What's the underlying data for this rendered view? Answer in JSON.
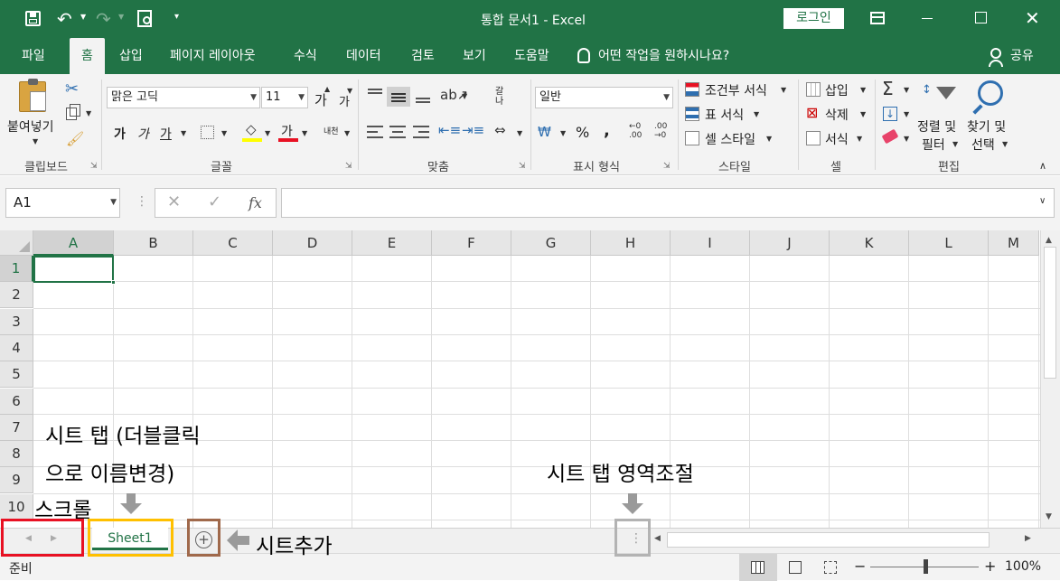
{
  "titlebar": {
    "title": "통합 문서1 - Excel",
    "login_label": "로그인",
    "bg_color": "#217346"
  },
  "ribbon_tabs": [
    "파일",
    "홈",
    "삽입",
    "페이지 레이아웃",
    "수식",
    "데이터",
    "검토",
    "보기",
    "도움말"
  ],
  "tell_me": "어떤 작업을 원하시나요?",
  "share_label": "공유",
  "clipboard": {
    "paste_label": "붙여넣기",
    "group_label": "클립보드"
  },
  "font": {
    "font_name": "맑은 고딕",
    "font_size": "11",
    "grow_label": "가",
    "shrink_label": "가",
    "bold": "가",
    "italic": "가",
    "underline": "가",
    "font_color_glyph": "가",
    "phonetic_glyph": "내천",
    "group_label": "글꼴"
  },
  "alignment": {
    "wrap_glyph": "갈나",
    "group_label": "맞춤"
  },
  "number": {
    "format": "일반",
    "percent": "%",
    "comma": ",",
    "group_label": "표시 형식"
  },
  "styles": {
    "conditional": "조건부 서식",
    "table": "표 서식",
    "cell_style": "셀 스타일",
    "group_label": "스타일"
  },
  "cells": {
    "insert": "삽입",
    "delete": "삭제",
    "format": "서식",
    "group_label": "셀"
  },
  "editing": {
    "sort_line1": "정렬 및",
    "sort_line2": "필터",
    "find_line1": "찾기 및",
    "find_line2": "선택",
    "group_label": "편집"
  },
  "formula_bar": {
    "name_box": "A1",
    "fx": "fx",
    "value": ""
  },
  "grid": {
    "columns": [
      "A",
      "B",
      "C",
      "D",
      "E",
      "F",
      "G",
      "H",
      "I",
      "J",
      "K",
      "L",
      "M"
    ],
    "rows": [
      "1",
      "2",
      "3",
      "4",
      "5",
      "6",
      "7",
      "8",
      "9",
      "10"
    ],
    "active_cell": "A1"
  },
  "sheet_tabs": {
    "tabs": [
      "Sheet1"
    ]
  },
  "annotations": {
    "tab_line1": "시트 탭 (더블클릭",
    "tab_line2": "으로 이름변경)",
    "resize": "시트 탭 영역조절",
    "scroll": "스크롤",
    "add_sheet": "시트추가"
  },
  "status": {
    "ready": "준비",
    "zoom": "100%"
  }
}
